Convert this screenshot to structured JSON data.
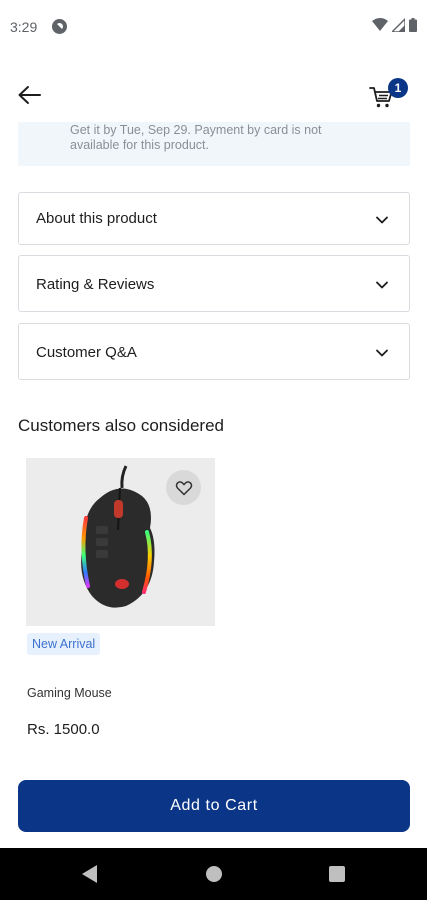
{
  "status_bar": {
    "time": "3:29",
    "icons": [
      "notification-app-icon",
      "wifi-icon",
      "signal-icon",
      "battery-icon"
    ]
  },
  "app_bar": {
    "back_icon": "arrow-left-icon",
    "cart_icon": "cart-icon",
    "cart_count": "1"
  },
  "delivery": {
    "line1": "Get it by Tue, Sep 29. Payment by card is not",
    "line2": "available for this product."
  },
  "sections": [
    {
      "label": "About this product"
    },
    {
      "label": "Rating & Reviews"
    },
    {
      "label": "Customer Q&A"
    }
  ],
  "recommendations": {
    "title": "Customers also considered",
    "products": [
      {
        "badge": "New Arrival",
        "name": "Gaming Mouse",
        "price": "Rs. 1500.0"
      }
    ]
  },
  "actions": {
    "add_to_cart": "Add to Cart"
  },
  "colors": {
    "primary": "#0b3688",
    "badge_bg": "#e7f0fd",
    "badge_text": "#3c72cf",
    "delivery_bg": "#f1f6fa"
  }
}
